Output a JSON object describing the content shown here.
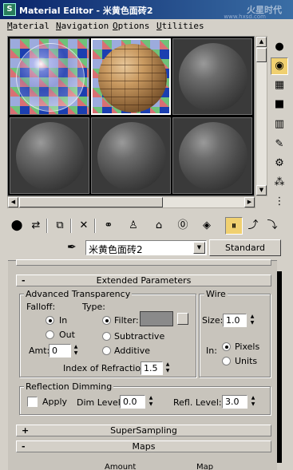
{
  "window": {
    "title": "Material Editor - 米黄色面砖2",
    "watermark": "火星时代",
    "watermark_url": "www.hxsd.com"
  },
  "menu": [
    "Material",
    "Navigation",
    "Options",
    "Utilities"
  ],
  "slots": [
    {
      "type": "glass",
      "selected": false
    },
    {
      "type": "brick",
      "selected": true
    },
    {
      "type": "default",
      "selected": false
    },
    {
      "type": "default",
      "selected": false
    },
    {
      "type": "default",
      "selected": false
    },
    {
      "type": "default",
      "selected": false
    }
  ],
  "material_name": "米黄色面砖2",
  "material_type_button": "Standard",
  "rollouts": {
    "top_partial": {
      "sign": ""
    },
    "extended": {
      "sign": "-",
      "title": "Extended Parameters"
    },
    "supersampling": {
      "sign": "+",
      "title": "SuperSampling"
    },
    "maps": {
      "sign": "-",
      "title": "Maps"
    }
  },
  "advanced_transparency": {
    "group_label": "Advanced Transparency",
    "falloff_label": "Falloff:",
    "type_label": "Type:",
    "falloff_in": "In",
    "falloff_out": "Out",
    "falloff_selected": "In",
    "type_filter": "Filter:",
    "type_subtractive": "Subtractive",
    "type_additive": "Additive",
    "type_selected": "Filter:",
    "filter_color": "#8a8a8a",
    "amt_label": "Amt:",
    "amt_value": "0",
    "ior_label": "Index of Refraction:",
    "ior_value": "1.5"
  },
  "wire": {
    "group_label": "Wire",
    "size_label": "Size:",
    "size_value": "1.0",
    "in_label": "In:",
    "pixels": "Pixels",
    "units": "Units",
    "selected": "Pixels"
  },
  "reflection_dimming": {
    "group_label": "Reflection Dimming",
    "apply_label": "Apply",
    "apply_checked": false,
    "dim_level_label": "Dim Level:",
    "dim_level_value": "0.0",
    "refl_level_label": "Refl. Level:",
    "refl_level_value": "3.0"
  },
  "maps_partial_labels": [
    "Amount",
    "Map"
  ]
}
